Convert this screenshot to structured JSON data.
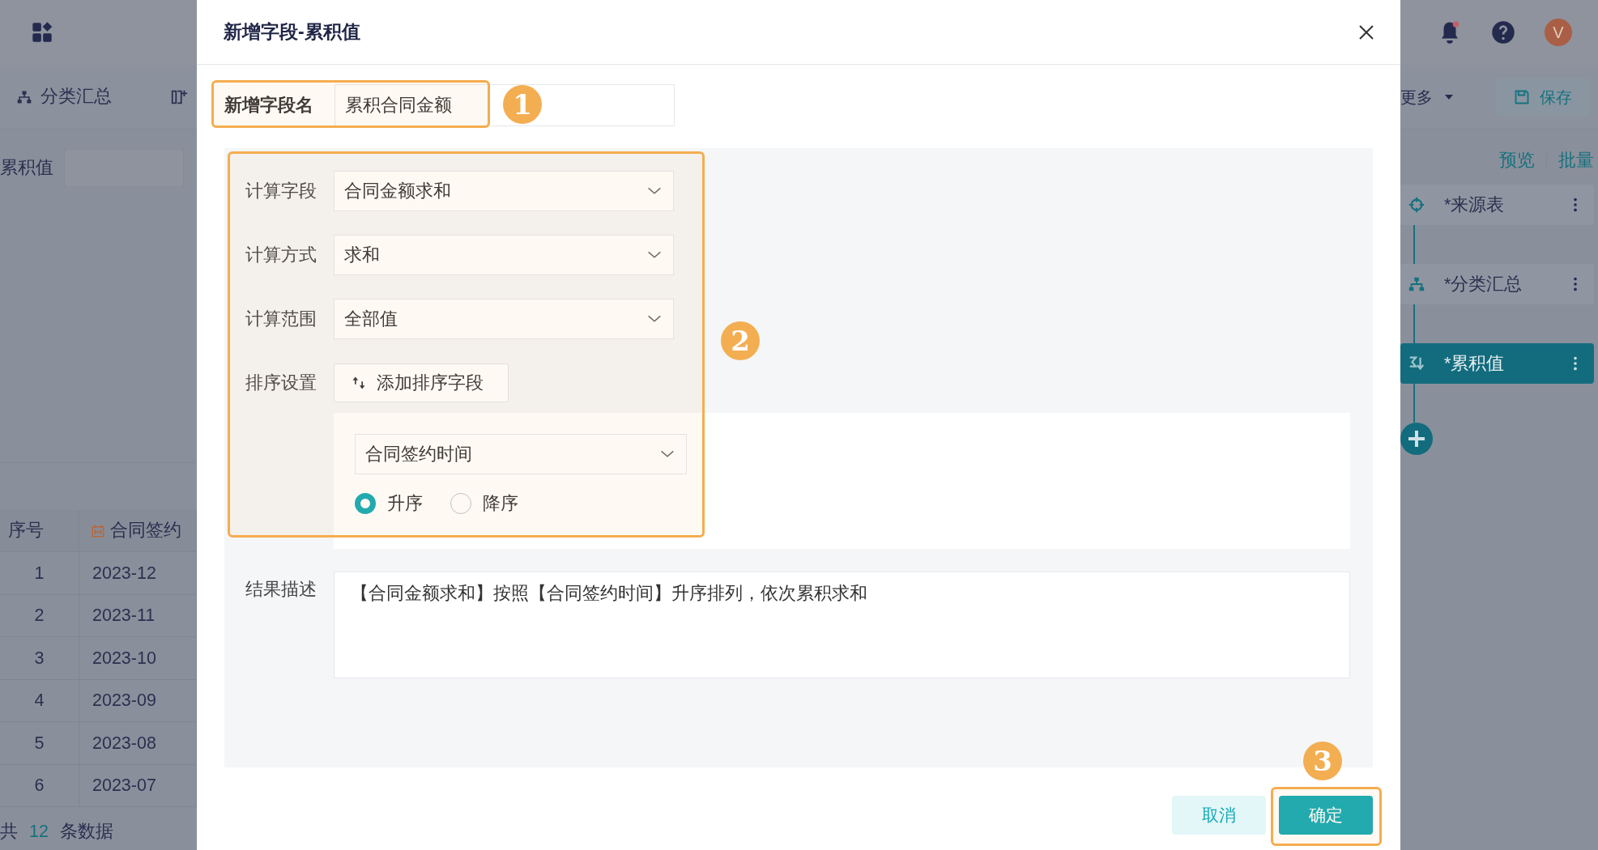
{
  "background": {
    "toolbar_left": {
      "label": "分类汇总"
    },
    "field_label": "累积值",
    "table": {
      "columns": [
        "序号",
        "合同签约"
      ],
      "rows": [
        [
          "1",
          "2023-12"
        ],
        [
          "2",
          "2023-11"
        ],
        [
          "3",
          "2023-10"
        ],
        [
          "4",
          "2023-09"
        ],
        [
          "5",
          "2023-08"
        ],
        [
          "6",
          "2023-07"
        ]
      ]
    },
    "footer": {
      "prefix": "共",
      "count": "12",
      "suffix": "条数据"
    },
    "avatar": "V",
    "more": "更多",
    "save": "保存",
    "links": [
      "预览",
      "批量"
    ],
    "flow_nodes": [
      {
        "label": "*来源表",
        "kind": "source",
        "selected": false
      },
      {
        "label": "*分类汇总",
        "kind": "group",
        "selected": false
      },
      {
        "label": "*累积值",
        "kind": "cumulative",
        "selected": true
      }
    ]
  },
  "dialog": {
    "title": "新增字段-累积值",
    "field_name": {
      "label": "新增字段名",
      "value": "累积合同金额"
    },
    "form_rows": [
      {
        "label": "计算字段",
        "kind": "select",
        "value": "合同金额求和"
      },
      {
        "label": "计算方式",
        "kind": "select",
        "value": "求和"
      },
      {
        "label": "计算范围",
        "kind": "select",
        "value": "全部值"
      },
      {
        "label": "排序设置",
        "kind": "button",
        "value": "添加排序字段"
      }
    ],
    "sort": {
      "field": "合同签约时间",
      "options": [
        {
          "label": "升序",
          "selected": true
        },
        {
          "label": "降序",
          "selected": false
        }
      ]
    },
    "description": {
      "label": "结果描述",
      "value": "【合同金额求和】按照【合同签约时间】升序排列，依次累积求和"
    },
    "buttons": [
      {
        "label": "取消",
        "kind": "secondary"
      },
      {
        "label": "确定",
        "kind": "primary"
      }
    ]
  },
  "annotations": [
    "1",
    "2",
    "3"
  ]
}
